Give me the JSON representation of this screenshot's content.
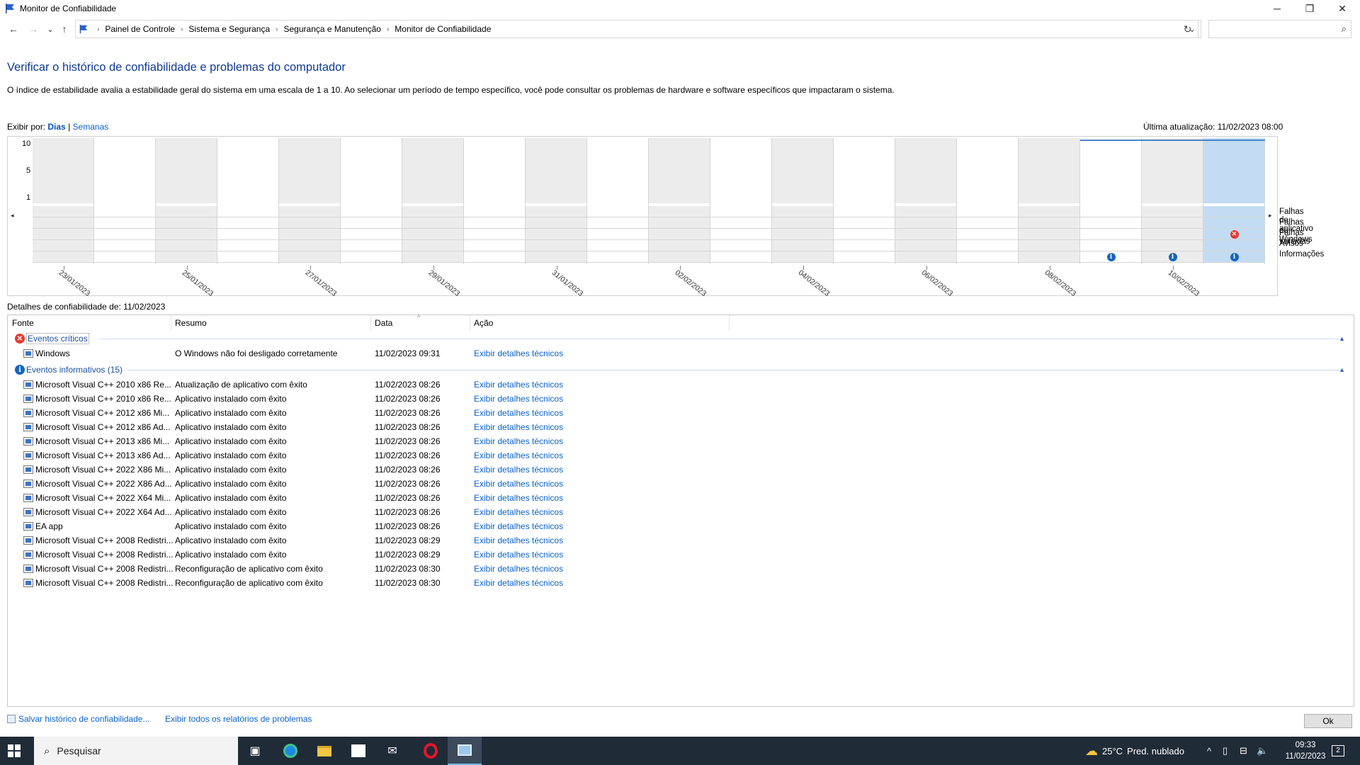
{
  "window": {
    "title": "Monitor de Confiabilidade",
    "controls": {
      "minimize": "─",
      "restore": "❐",
      "close": "✕"
    }
  },
  "nav": {
    "back": "←",
    "forward": "→",
    "recent": "⌄",
    "up": "↑",
    "breadcrumbs": [
      "Painel de Controle",
      "Sistema e Segurança",
      "Segurança e Manutenção",
      "Monitor de Confiabilidade"
    ],
    "search_placeholder": ""
  },
  "page": {
    "heading": "Verificar o histórico de confiabilidade e problemas do computador",
    "description": "O índice de estabilidade avalia a estabilidade geral do sistema em uma escala de 1 a 10. Ao selecionar um período de tempo específico, você pode consultar os problemas de hardware e software específicos que impactaram o sistema.",
    "view_by_label": "Exibir por:",
    "view_days": "Dias",
    "view_sep": "|",
    "view_weeks": "Semanas",
    "last_update": "Última atualização: 11/02/2023 08:00"
  },
  "chart_data": {
    "type": "line",
    "y_ticks": [
      "10",
      "5",
      "1"
    ],
    "ylim": [
      1,
      10
    ],
    "days": 20,
    "selected_day": 19,
    "gray_days": [
      0,
      2,
      4,
      6,
      8,
      10,
      12,
      14,
      16,
      18
    ],
    "stability": [
      {
        "day": 17,
        "value": 10
      },
      {
        "day": 18,
        "value": 10
      },
      {
        "day": 19,
        "value": 10
      }
    ],
    "row_labels": [
      "Falhas de aplicativo",
      "Falhas do Windows",
      "Falhas variadas",
      "Avisos",
      "Informações"
    ],
    "x_labels": [
      "23/01/2023",
      "25/01/2023",
      "27/01/2023",
      "29/01/2023",
      "31/01/2023",
      "02/02/2023",
      "04/02/2023",
      "06/02/2023",
      "08/02/2023",
      "10/02/2023"
    ],
    "events": [
      {
        "day": 19,
        "row": 2,
        "kind": "error"
      },
      {
        "day": 17,
        "row": 4,
        "kind": "info"
      },
      {
        "day": 18,
        "row": 4,
        "kind": "info"
      },
      {
        "day": 19,
        "row": 4,
        "kind": "info"
      }
    ],
    "colors": {
      "selected": "#c3dcf3",
      "gray": "#ececec",
      "line": "#4a87c9",
      "info": "#1565c0",
      "error": "#e23b30"
    }
  },
  "details": {
    "title": "Detalhes de confiabilidade de: 11/02/2023",
    "columns": [
      "Fonte",
      "Resumo",
      "Data",
      "Ação"
    ],
    "critical": {
      "label": "Eventos críticos",
      "rows": [
        {
          "source": "Windows",
          "summary": "O Windows não foi desligado corretamente",
          "date": "11/02/2023 09:31",
          "action": "Exibir detalhes técnicos"
        }
      ]
    },
    "info": {
      "label": "Eventos informativos (15)",
      "rows": [
        {
          "source": "Microsoft Visual C++ 2010  x86 Re...",
          "summary": "Atualização de aplicativo com êxito",
          "date": "11/02/2023 08:26",
          "action": "Exibir detalhes técnicos"
        },
        {
          "source": "Microsoft Visual C++ 2010  x86 Re...",
          "summary": "Aplicativo instalado com êxito",
          "date": "11/02/2023 08:26",
          "action": "Exibir detalhes técnicos"
        },
        {
          "source": "Microsoft Visual C++ 2012 x86 Mi...",
          "summary": "Aplicativo instalado com êxito",
          "date": "11/02/2023 08:26",
          "action": "Exibir detalhes técnicos"
        },
        {
          "source": "Microsoft Visual C++ 2012 x86 Ad...",
          "summary": "Aplicativo instalado com êxito",
          "date": "11/02/2023 08:26",
          "action": "Exibir detalhes técnicos"
        },
        {
          "source": "Microsoft Visual C++ 2013 x86 Mi...",
          "summary": "Aplicativo instalado com êxito",
          "date": "11/02/2023 08:26",
          "action": "Exibir detalhes técnicos"
        },
        {
          "source": "Microsoft Visual C++ 2013 x86 Ad...",
          "summary": "Aplicativo instalado com êxito",
          "date": "11/02/2023 08:26",
          "action": "Exibir detalhes técnicos"
        },
        {
          "source": "Microsoft Visual C++ 2022 X86 Mi...",
          "summary": "Aplicativo instalado com êxito",
          "date": "11/02/2023 08:26",
          "action": "Exibir detalhes técnicos"
        },
        {
          "source": "Microsoft Visual C++ 2022 X86 Ad...",
          "summary": "Aplicativo instalado com êxito",
          "date": "11/02/2023 08:26",
          "action": "Exibir detalhes técnicos"
        },
        {
          "source": "Microsoft Visual C++ 2022 X64 Mi...",
          "summary": "Aplicativo instalado com êxito",
          "date": "11/02/2023 08:26",
          "action": "Exibir detalhes técnicos"
        },
        {
          "source": "Microsoft Visual C++ 2022 X64 Ad...",
          "summary": "Aplicativo instalado com êxito",
          "date": "11/02/2023 08:26",
          "action": "Exibir detalhes técnicos"
        },
        {
          "source": "EA app",
          "summary": "Aplicativo instalado com êxito",
          "date": "11/02/2023 08:26",
          "action": "Exibir detalhes técnicos"
        },
        {
          "source": "Microsoft Visual C++ 2008 Redistri...",
          "summary": "Aplicativo instalado com êxito",
          "date": "11/02/2023 08:29",
          "action": "Exibir detalhes técnicos"
        },
        {
          "source": "Microsoft Visual C++ 2008 Redistri...",
          "summary": "Aplicativo instalado com êxito",
          "date": "11/02/2023 08:29",
          "action": "Exibir detalhes técnicos"
        },
        {
          "source": "Microsoft Visual C++ 2008 Redistri...",
          "summary": "Reconfiguração de aplicativo com êxito",
          "date": "11/02/2023 08:30",
          "action": "Exibir detalhes técnicos"
        },
        {
          "source": "Microsoft Visual C++ 2008 Redistri...",
          "summary": "Reconfiguração de aplicativo com êxito",
          "date": "11/02/2023 08:30",
          "action": "Exibir detalhes técnicos"
        }
      ]
    }
  },
  "footer": {
    "save_link": "Salvar histórico de confiabilidade...",
    "reports_link": "Exibir todos os relatórios de problemas",
    "ok": "Ok"
  },
  "taskbar": {
    "search_label": "Pesquisar",
    "weather_temp": "25°C",
    "weather_desc": "Pred. nublado",
    "time": "09:33",
    "date": "11/02/2023",
    "notification_count": "2"
  }
}
